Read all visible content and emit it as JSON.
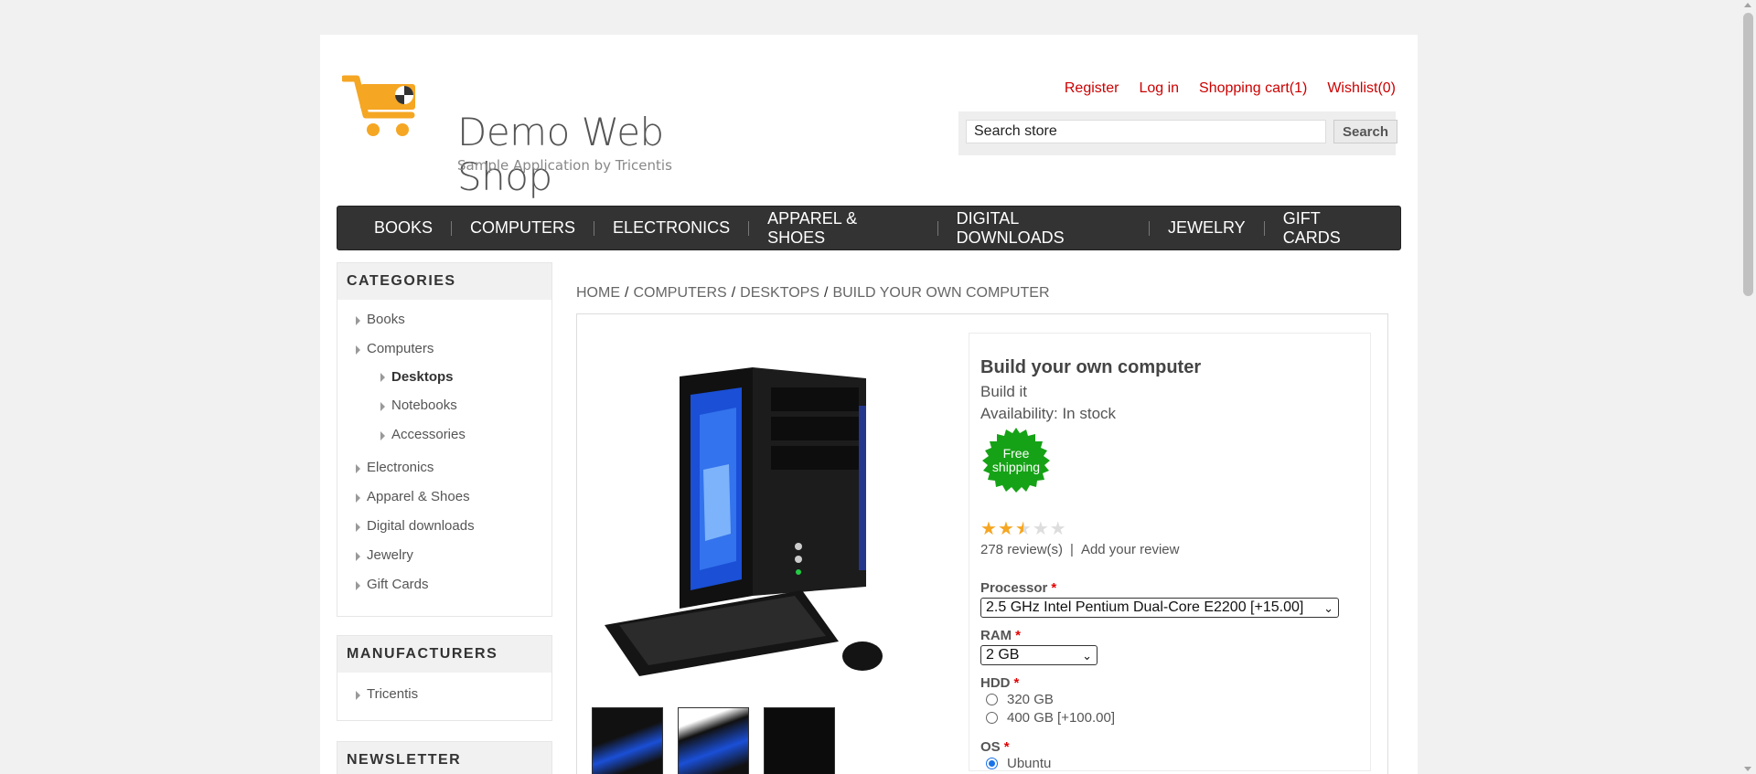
{
  "header": {
    "logo_title": "Demo Web Shop",
    "logo_subtitle": "Sample Application by Tricentis",
    "links": {
      "register": "Register",
      "login": "Log in",
      "cart": "Shopping cart(1)",
      "wishlist": "Wishlist(0)"
    },
    "search": {
      "value": "Search store",
      "button": "Search"
    }
  },
  "topmenu": [
    "BOOKS",
    "COMPUTERS",
    "ELECTRONICS",
    "APPAREL & SHOES",
    "DIGITAL DOWNLOADS",
    "JEWELRY",
    "GIFT CARDS"
  ],
  "sidebar": {
    "categories_title": "CATEGORIES",
    "categories": [
      "Books",
      "Computers",
      "Desktops",
      "Notebooks",
      "Accessories",
      "Electronics",
      "Apparel & Shoes",
      "Digital downloads",
      "Jewelry",
      "Gift Cards"
    ],
    "manufacturers_title": "MANUFACTURERS",
    "manufacturers": [
      "Tricentis"
    ],
    "newsletter_title": "NEWSLETTER"
  },
  "breadcrumb": [
    "HOME",
    "COMPUTERS",
    "DESKTOPS",
    "BUILD YOUR OWN COMPUTER"
  ],
  "product": {
    "name": "Build your own computer",
    "short_description": "Build it",
    "availability": "Availability: In stock",
    "free_shipping": "Free shipping",
    "free_shipping_line1": "Free",
    "free_shipping_line2": "shipping",
    "rating": 2.5,
    "rating_max": 5,
    "reviews_count": "278 review(s)",
    "add_review": "Add your review",
    "reviews_divider": "|",
    "attributes": {
      "processor": {
        "label": "Processor",
        "required_mark": "*",
        "selected": "2.5 GHz Intel Pentium Dual-Core E2200 [+15.00]"
      },
      "ram": {
        "label": "RAM",
        "required_mark": "*",
        "selected": "2 GB"
      },
      "hdd": {
        "label": "HDD",
        "required_mark": "*",
        "options": [
          "320 GB",
          "400 GB [+100.00]"
        ]
      },
      "os": {
        "label": "OS",
        "required_mark": "*",
        "options": [
          "Ubuntu"
        ],
        "selected": "Ubuntu"
      }
    }
  },
  "colors": {
    "accent_link": "#cc0000",
    "menu_bg": "#333333",
    "free_shipping_badge": "#16a216",
    "star_filled": "#f5a623",
    "star_empty": "#dddddd"
  }
}
